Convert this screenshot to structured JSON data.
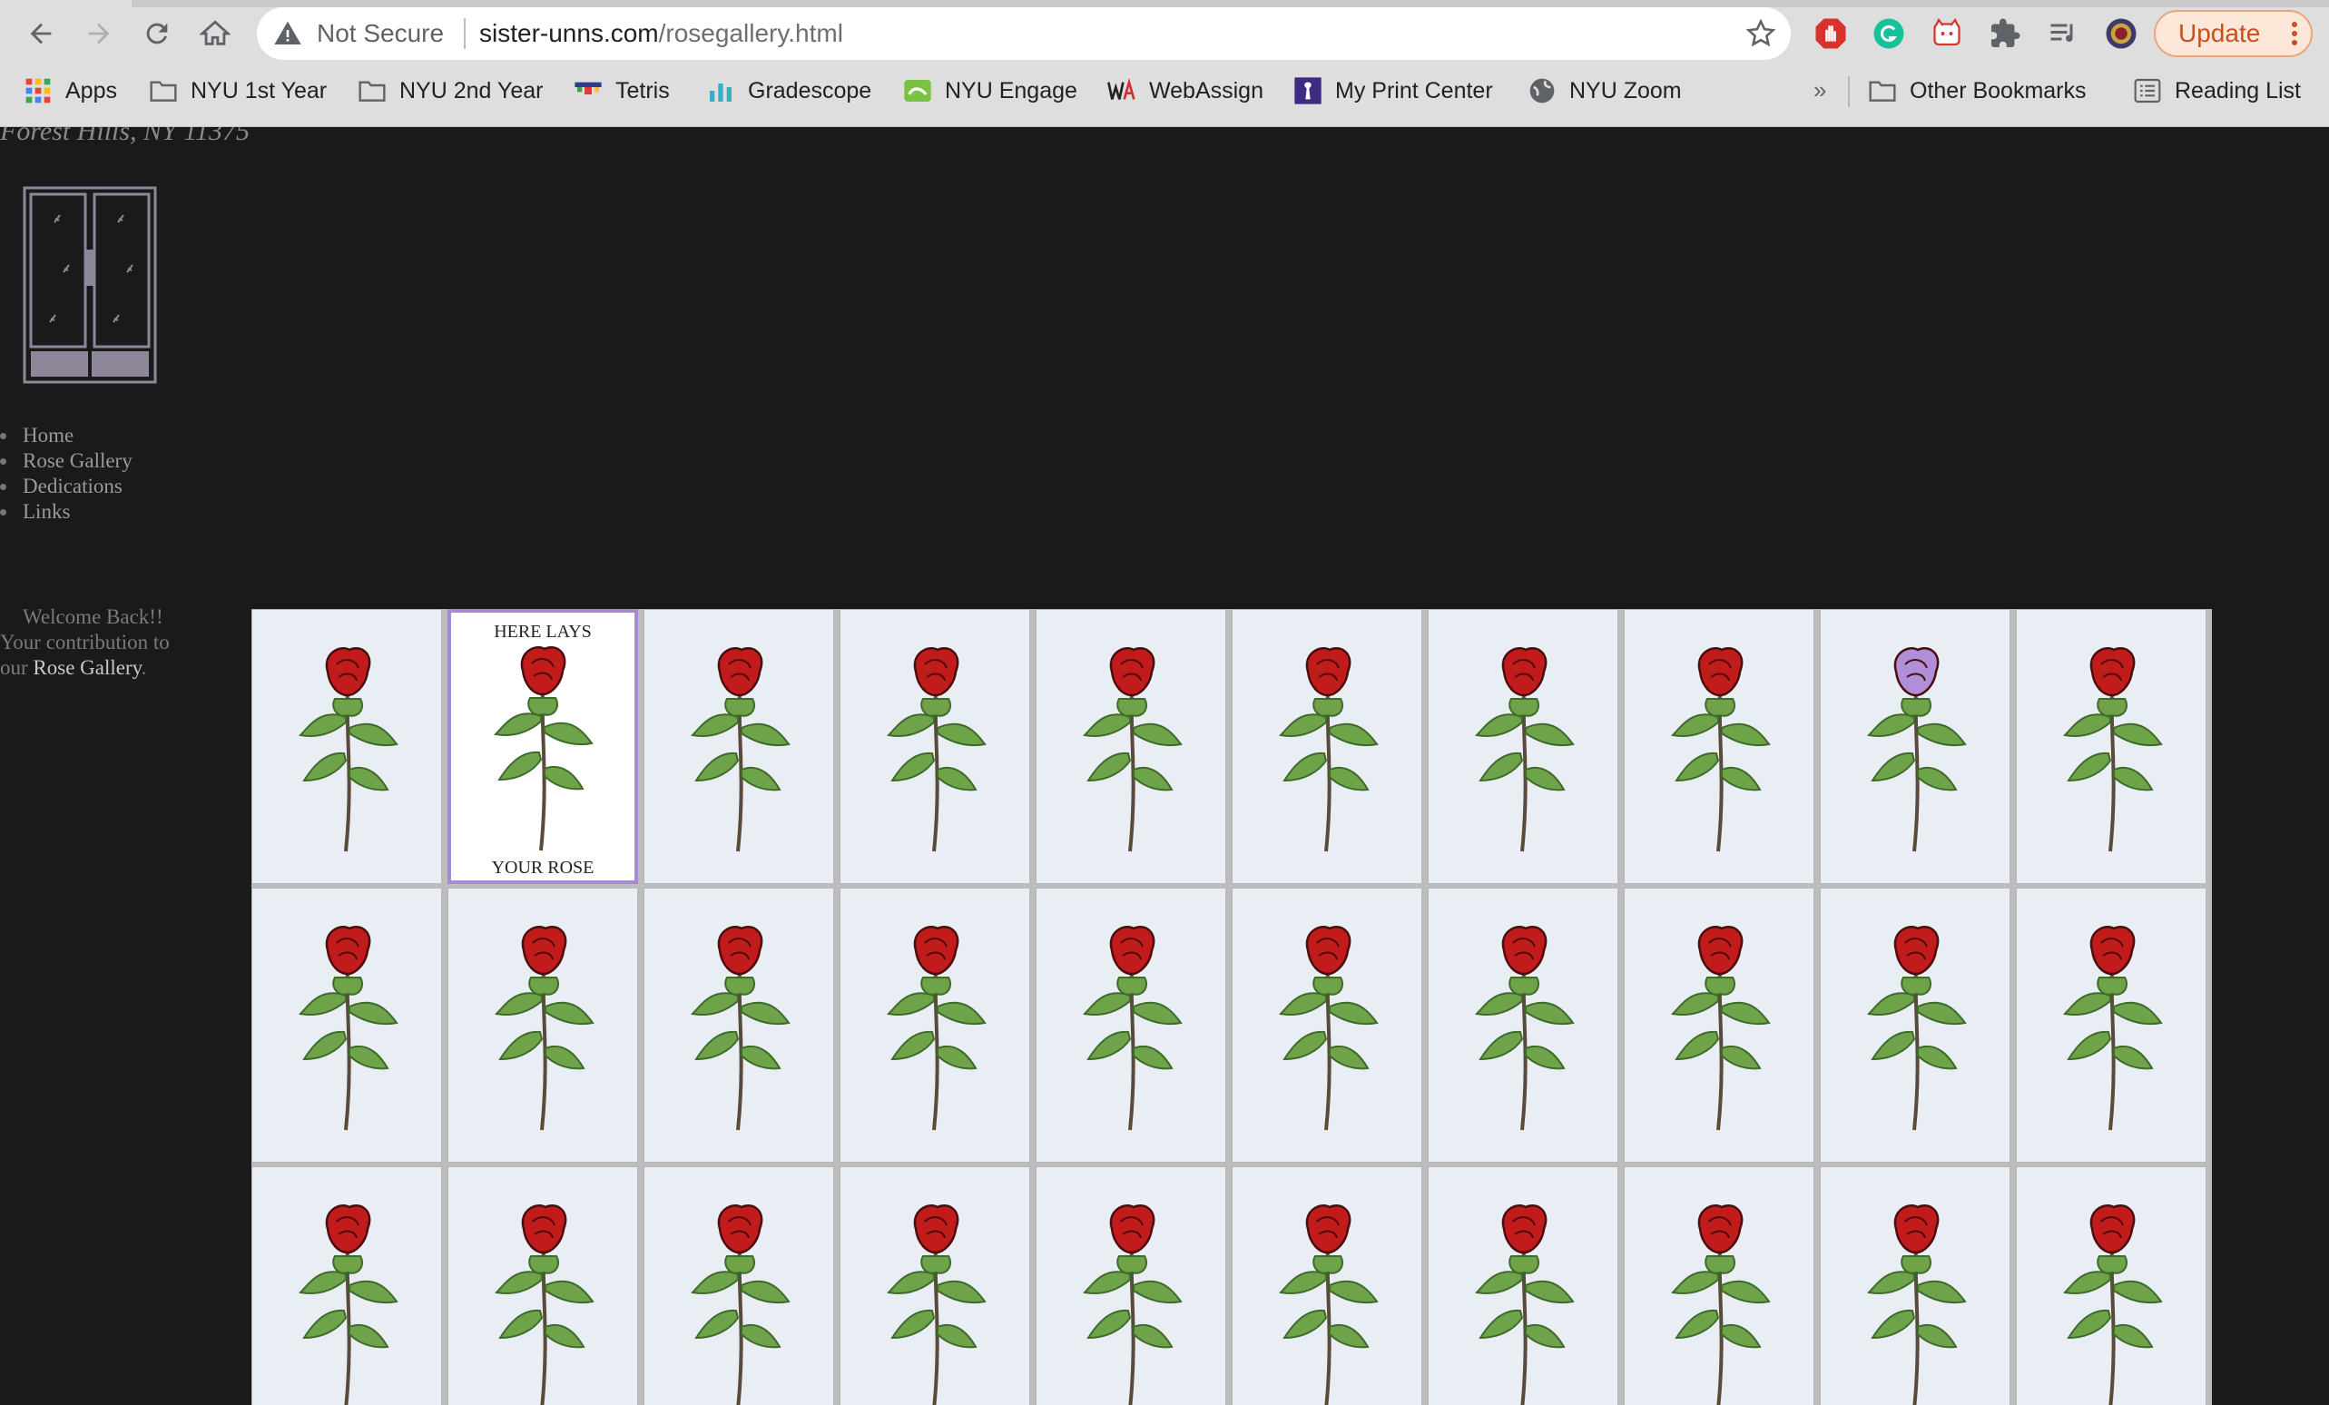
{
  "browser": {
    "security_label": "Not Secure",
    "url_domain": "sister-unns.com",
    "url_path": "/rosegallery.html",
    "update_label": "Update",
    "bookmarks": [
      {
        "label": "Apps",
        "icon": "apps-grid-icon"
      },
      {
        "label": "NYU 1st Year",
        "icon": "folder-icon"
      },
      {
        "label": "NYU 2nd Year",
        "icon": "folder-icon"
      },
      {
        "label": "Tetris",
        "icon": "tetris-icon"
      },
      {
        "label": "Gradescope",
        "icon": "gradescope-icon"
      },
      {
        "label": "NYU Engage",
        "icon": "nyu-engage-icon"
      },
      {
        "label": "WebAssign",
        "icon": "webassign-icon"
      },
      {
        "label": "My Print Center",
        "icon": "print-center-icon"
      },
      {
        "label": "NYU Zoom",
        "icon": "globe-icon"
      }
    ],
    "overflow_label": "»",
    "other_bookmarks": "Other Bookmarks",
    "reading_list": "Reading List"
  },
  "site": {
    "address": "Forest Hills, NY 11375",
    "nav": [
      {
        "label": "Home"
      },
      {
        "label": "Rose Gallery"
      },
      {
        "label": "Dedications"
      },
      {
        "label": "Links"
      }
    ],
    "welcome": {
      "line1": "Welcome Back!!",
      "line2": "Your contribution to",
      "line3_prefix": "our ",
      "link": "Rose Gallery",
      "line3_suffix": "."
    }
  },
  "gallery": {
    "columns": 10,
    "rows": [
      [
        "red",
        "red",
        "red",
        "red",
        "red",
        "red",
        "red",
        "red",
        "purple",
        "red"
      ],
      [
        "red",
        "red",
        "red",
        "red",
        "red",
        "red",
        "red",
        "red",
        "red",
        "red"
      ],
      [
        "red",
        "red",
        "red",
        "red",
        "red",
        "red",
        "red",
        "red",
        "red",
        "red"
      ]
    ],
    "selected": {
      "row": 0,
      "col": 1
    },
    "selected_top_caption": "HERE LAYS",
    "selected_bottom_caption": "YOUR ROSE",
    "colors": {
      "red": "#c11b1b",
      "purple": "#b18ed8",
      "leaf": "#6fa34a",
      "stem": "#5a4a3a"
    }
  }
}
